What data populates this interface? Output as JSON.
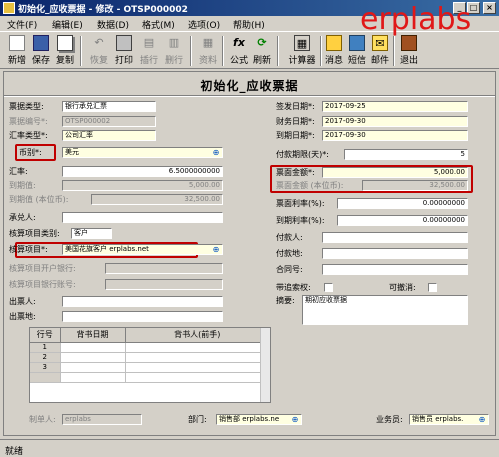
{
  "window": {
    "title": "初始化_应收票据 - 修改 - OTSP000002",
    "min": "_",
    "max": "□",
    "close": "×"
  },
  "menu": [
    {
      "label": "文件(F)"
    },
    {
      "label": "编辑(E)"
    },
    {
      "label": "数据(D)"
    },
    {
      "label": "格式(M)"
    },
    {
      "label": "选项(O)"
    },
    {
      "label": "帮助(H)"
    }
  ],
  "toolbar": {
    "new": "新增",
    "save": "保存",
    "copy": "复制",
    "restore": "恢复",
    "print": "打印",
    "insert": "插行",
    "delete": "删行",
    "info": "资料",
    "formula": "公式",
    "refresh": "刷新",
    "calculator": "计算器",
    "message": "消息",
    "sms": "短信",
    "mail": "邮件",
    "exit": "退出"
  },
  "brand": "erplabs",
  "form": {
    "title": "初始化_应收票据",
    "bill_type": {
      "label": "票据类型:",
      "value": "银行承兑汇票"
    },
    "bill_no": {
      "label": "票据编号*:",
      "value": "OTSP000002"
    },
    "exchange_type": {
      "label": "汇率类型*:",
      "value": "公司汇率"
    },
    "currency": {
      "label": "币别*:",
      "value": "美元"
    },
    "rate": {
      "label": "汇率:",
      "value": "6.5000000000"
    },
    "maturity_value": {
      "label": "到期值:",
      "value": "5,000.00"
    },
    "maturity_value_base": {
      "label": "到期值 (本位币):",
      "value": "32,500.00"
    },
    "acceptor": {
      "label": "承兑人:",
      "value": ""
    },
    "account_item_type": {
      "label": "核算项目类别:",
      "value": "客户"
    },
    "account_item": {
      "label": "核算项目*:",
      "value": "美国花旗客户 erplabs.net"
    },
    "bank": {
      "label": "核算项目开户银行:",
      "value": ""
    },
    "bank_account": {
      "label": "核算项目银行账号:",
      "value": ""
    },
    "drawer": {
      "label": "出票人:",
      "value": ""
    },
    "draw_place": {
      "label": "出票地:",
      "value": ""
    },
    "sign_date": {
      "label": "签发日期*:",
      "value": "2017-09-25"
    },
    "fin_date": {
      "label": "财务日期*:",
      "value": "2017-09-30"
    },
    "due_date": {
      "label": "到期日期*:",
      "value": "2017-09-30"
    },
    "term": {
      "label": "付款期限(天)*:",
      "value": "5"
    },
    "face_amount": {
      "label": "票面金额*:",
      "value": "5,000.00"
    },
    "face_amount_base": {
      "label": "票面金额 (本位币):",
      "value": "32,500.00"
    },
    "face_rate": {
      "label": "票面利率(%):",
      "value": "0.00000000"
    },
    "due_rate": {
      "label": "到期利率(%):",
      "value": "0.00000000"
    },
    "payer": {
      "label": "付款人:",
      "value": ""
    },
    "pay_place": {
      "label": "付款地:",
      "value": ""
    },
    "contract_no": {
      "label": "合同号:",
      "value": ""
    },
    "recourse": {
      "label": "带追索权:"
    },
    "cancelable": {
      "label": "可撤消:"
    },
    "summary": {
      "label": "摘要:",
      "value": "期初应收票据"
    },
    "grid": {
      "headers": [
        "行号",
        "背书日期",
        "背书人(前手)"
      ],
      "rows": [
        "1",
        "2",
        "3"
      ]
    },
    "maker": {
      "label": "制单人:",
      "value": "erplabs"
    },
    "dept": {
      "label": "部门:",
      "value": "销售部 erplabs.ne"
    },
    "salesman": {
      "label": "业务员:",
      "value": "销售员 erplabs."
    }
  },
  "status": "就绪"
}
